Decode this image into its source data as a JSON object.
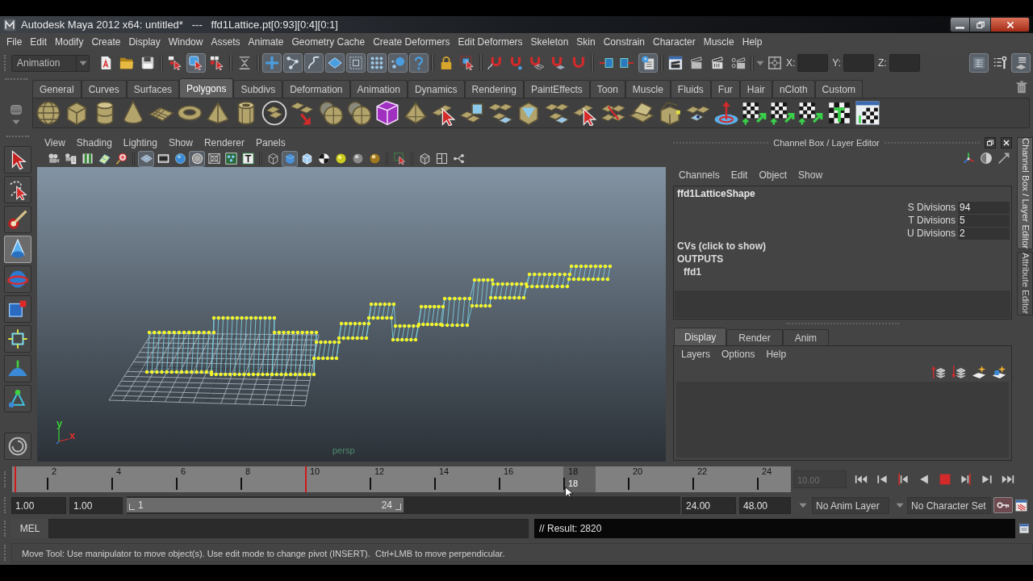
{
  "window": {
    "title": "Autodesk Maya 2012 x64: untitled*   ---   ffd1Lattice.pt[0:93][0:4][0:1]"
  },
  "menu_bar": [
    "File",
    "Edit",
    "Modify",
    "Create",
    "Display",
    "Window",
    "Assets",
    "Animate",
    "Geometry Cache",
    "Create Deformers",
    "Edit Deformers",
    "Skeleton",
    "Skin",
    "Constrain",
    "Character",
    "Muscle",
    "Help"
  ],
  "status_line": {
    "menu_set": "Animation",
    "groups": [
      [
        {
          "kind": "doc",
          "on": false
        },
        {
          "kind": "folder",
          "on": false
        },
        {
          "kind": "floppy",
          "on": false
        }
      ],
      [
        {
          "kind": "hierarchy",
          "on": false
        },
        {
          "kind": "object",
          "on": true
        },
        {
          "kind": "component",
          "on": false
        }
      ],
      [
        {
          "kind": "collapse",
          "on": false
        }
      ],
      [
        {
          "kind": "plus",
          "on": true
        },
        {
          "kind": "nodes",
          "on": true
        },
        {
          "kind": "curve",
          "on": true
        },
        {
          "kind": "diamond",
          "on": true
        },
        {
          "kind": "dotgrid",
          "on": true
        },
        {
          "kind": "dots",
          "on": true
        },
        {
          "kind": "particles",
          "on": true
        },
        {
          "kind": "question",
          "on": true
        }
      ],
      [
        {
          "kind": "lock",
          "on": false
        },
        {
          "kind": "boxsel",
          "on": false
        }
      ],
      [
        {
          "kind": "magnet-curve",
          "on": false
        },
        {
          "kind": "magnet-point",
          "on": false
        },
        {
          "kind": "magnet-grid",
          "on": false
        },
        {
          "kind": "magnet-surface",
          "on": false
        },
        {
          "kind": "magnet",
          "on": false
        }
      ],
      [
        {
          "kind": "inputs",
          "on": false
        },
        {
          "kind": "outputs",
          "on": false
        },
        {
          "kind": "history",
          "on": true
        }
      ],
      [
        {
          "kind": "render-window",
          "on": false
        },
        {
          "kind": "clapper",
          "on": false
        },
        {
          "kind": "ipr",
          "on": false
        },
        {
          "kind": "clapper-dots",
          "on": false
        }
      ]
    ],
    "coordinate_fields": [
      {
        "label": "X:"
      },
      {
        "label": "Y:"
      },
      {
        "label": "Z:"
      }
    ],
    "panel_toggles": [
      {
        "kind": "channel-box",
        "on": true
      },
      {
        "kind": "tool-settings",
        "on": false
      },
      {
        "kind": "attribute-editor",
        "on": true
      }
    ]
  },
  "shelf": {
    "tabs": [
      {
        "label": "General",
        "selected": false
      },
      {
        "label": "Curves",
        "selected": false
      },
      {
        "label": "Surfaces",
        "selected": false
      },
      {
        "label": "Polygons",
        "selected": true
      },
      {
        "label": "Subdivs",
        "selected": false
      },
      {
        "label": "Deformation",
        "selected": false
      },
      {
        "label": "Animation",
        "selected": false
      },
      {
        "label": "Dynamics",
        "selected": false
      },
      {
        "label": "Rendering",
        "selected": false
      },
      {
        "label": "PaintEffects",
        "selected": false
      },
      {
        "label": "Toon",
        "selected": false
      },
      {
        "label": "Muscle",
        "selected": false
      },
      {
        "label": "Fluids",
        "selected": false
      },
      {
        "label": "Fur",
        "selected": false
      },
      {
        "label": "Hair",
        "selected": false
      },
      {
        "label": "nCloth",
        "selected": false
      },
      {
        "label": "Custom",
        "selected": false
      }
    ]
  },
  "toolbox": {
    "tools": [
      {
        "kind": "select",
        "selected": false
      },
      {
        "kind": "lasso",
        "selected": false
      },
      {
        "kind": "paint",
        "selected": false
      },
      {
        "kind": "move",
        "selected": true
      },
      {
        "kind": "rotate",
        "selected": false
      },
      {
        "kind": "scale",
        "selected": false
      },
      {
        "kind": "universal",
        "selected": false
      },
      {
        "kind": "soft-mod",
        "selected": false
      },
      {
        "kind": "show-manip",
        "selected": false
      },
      {
        "kind": "last-tool",
        "selected": false
      }
    ]
  },
  "viewport": {
    "menus": [
      "View",
      "Shading",
      "Lighting",
      "Show",
      "Renderer",
      "Panels"
    ],
    "toolbar_groups": [
      [
        {
          "kind": "camera",
          "on": false
        },
        {
          "kind": "camera-list",
          "on": false
        },
        {
          "kind": "bookmark",
          "on": false
        },
        {
          "kind": "image-plane",
          "on": false
        },
        {
          "kind": "magnifier",
          "on": false
        }
      ],
      [
        {
          "kind": "grid",
          "on": true
        },
        {
          "kind": "film",
          "on": false
        },
        {
          "kind": "sphere-blue",
          "on": false
        },
        {
          "kind": "disc",
          "on": true
        },
        {
          "kind": "safe",
          "on": false
        },
        {
          "kind": "dots-box",
          "on": false
        },
        {
          "kind": "text-box",
          "on": false
        }
      ],
      [
        {
          "kind": "wire-cube",
          "on": false
        },
        {
          "kind": "shaded-cube",
          "on": true
        },
        {
          "kind": "xray-cube",
          "on": false
        },
        {
          "kind": "checker-ball",
          "on": false
        },
        {
          "kind": "light-yellow",
          "on": false
        },
        {
          "kind": "sphere-grey",
          "on": false
        },
        {
          "kind": "sphere-gold",
          "on": false
        }
      ],
      [
        {
          "kind": "isolate",
          "on": false
        }
      ],
      [
        {
          "kind": "cube-outline",
          "on": false
        },
        {
          "kind": "panels",
          "on": false
        },
        {
          "kind": "share",
          "on": false
        }
      ]
    ],
    "axes": [
      {
        "label": "y",
        "color": "#3ad03a"
      },
      {
        "label": "x",
        "color": "#e03030"
      }
    ],
    "camera": "persp"
  },
  "channel_box": {
    "title": "Channel Box / Layer Editor",
    "menus": [
      "Channels",
      "Edit",
      "Object",
      "Show"
    ],
    "node": "ffd1LatticeShape",
    "attributes": [
      {
        "name": "S Divisions",
        "value": "94"
      },
      {
        "name": "T Divisions",
        "value": "5"
      },
      {
        "name": "U Divisions",
        "value": "2"
      }
    ],
    "cvs_label": "CVs (click to show)",
    "outputs_heading": "OUTPUTS",
    "outputs": [
      "ffd1"
    ]
  },
  "layer_editor": {
    "tabs": [
      {
        "label": "Display",
        "selected": true
      },
      {
        "label": "Render",
        "selected": false
      },
      {
        "label": "Anim",
        "selected": false
      }
    ],
    "menus": [
      "Layers",
      "Options",
      "Help"
    ]
  },
  "side_tabs": [
    {
      "label": "Channel Box / Layer Editor",
      "selected": true
    },
    {
      "label": "Attribute Editor",
      "selected": false
    }
  ],
  "time_slider": {
    "ticks": [
      {
        "key": true,
        "selected": false
      },
      {
        "label": "2",
        "key": false,
        "selected": false
      },
      {
        "label": "4",
        "key": false,
        "selected": false
      },
      {
        "label": "6",
        "key": false,
        "selected": false
      },
      {
        "label": "8",
        "key": false,
        "selected": false
      },
      {
        "label": "10",
        "key": true,
        "selected": false
      },
      {
        "label": "12",
        "key": false,
        "selected": false
      },
      {
        "label": "14",
        "key": false,
        "selected": false
      },
      {
        "label": "16",
        "key": false,
        "selected": false
      },
      {
        "label": "18",
        "key": false,
        "selected": true
      },
      {
        "label": "20",
        "key": false,
        "selected": false
      },
      {
        "label": "22",
        "key": false,
        "selected": false
      },
      {
        "label": "24",
        "key": false,
        "selected": false
      }
    ],
    "current_frame": "18",
    "playback_field": {
      "value": "10.00",
      "disabled": true
    }
  },
  "range_slider": {
    "start_time": "1.00",
    "playback_start": "1.00",
    "range_start": "1",
    "range_end": "24",
    "level": 0.5,
    "playback_end": "24.00",
    "end_time": "48.00",
    "anim_layer": "No Anim Layer",
    "character_set": "No Character Set"
  },
  "command_line": {
    "language": "MEL",
    "result": "// Result: 2820"
  },
  "help_line": "Move Tool: Use manipulator to move object(s). Use edit mode to change pivot (INSERT).  Ctrl+LMB to move perpendicular."
}
